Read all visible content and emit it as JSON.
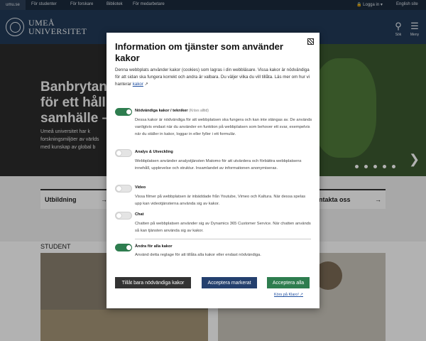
{
  "topbar": {
    "site_label": "umu.se",
    "links": [
      "För studenter",
      "För forskare",
      "Bibliotek",
      "För medarbetare"
    ],
    "login": "Logga in",
    "english": "English site"
  },
  "header": {
    "logo_line1": "UMEÅ",
    "logo_line2": "UNIVERSITET",
    "search_label": "Sök",
    "menu_label": "Meny"
  },
  "hero": {
    "title_line1": "Banbrytan",
    "title_line2": "för ett håll",
    "title_line3": "samhälle  –",
    "text_line1": "Umeå universitet har k",
    "text_line2": "forskningsmiljöer av världs",
    "text_line3": "med kunskap av global b"
  },
  "quicklinks": {
    "left": "Utbildning",
    "right": "ntakta oss"
  },
  "section": {
    "title": "STUDENT"
  },
  "dialog": {
    "title": "Information om tjänster som använder kakor",
    "intro": "Denna webbplats använder kakor (cookies) som lagras i din webbläsare. Vissa kakor är nödvändiga för att sidan ska fungera korrekt och andra är valbara. Du väljer vilka du vill tillåta. Läs mer om hur vi hanterar",
    "intro_link": "kakor",
    "options": [
      {
        "title": "Nödvändiga kakor / tekniker",
        "required": "(Krävs alltid)",
        "enabled": true,
        "description": "Dessa kakor är nödvändiga för att webbplatsen ska fungera och kan inte stängas av. De används vanligtvis endast när du använder en funktion på webbplatsen som behover ett svar, exempelvis när du ställer in kakor, loggar in eller fyller i ett formulär."
      },
      {
        "title": "Analys & Utveckling",
        "enabled": false,
        "description": "Webbplatsen använder analystjänsten Matomo för att utvärdera och förbättra webbplatsens innehåll, upplevelse och struktur. Insamlandet av informationen anonymiseras."
      },
      {
        "title": "Video",
        "enabled": false,
        "description": "Vissa filmer på webbplatsen är inbäddade från Youtube, Vimeo och Kaltura. När dessa spelas upp kan videotjänsterna använda sig av kakor."
      },
      {
        "title": "Chat",
        "enabled": false,
        "description": "Chatten på webbplatsen använder sig av Dynamics 365 Customer Service. När chatten används så kan tjänsten använda sig av kakor."
      },
      {
        "title": "Ändra för alla kakor",
        "enabled": true,
        "description": "Använd detta reglage för att tillåta alla kakor eller endast nödvändiga."
      }
    ],
    "btn_necessary": "Tillåt bara nödvändiga kakor",
    "btn_selected": "Acceptera markerat",
    "btn_all": "Acceptera alla",
    "powered": "Körs på Klaro!"
  },
  "colors": {
    "header": "#213a58",
    "topbar": "#1a2a3d",
    "toggle_on": "#2e7d4f",
    "btn_dark": "#333333",
    "btn_blue": "#24406e",
    "btn_green": "#2e7d4f",
    "link": "#1f4fa0"
  }
}
